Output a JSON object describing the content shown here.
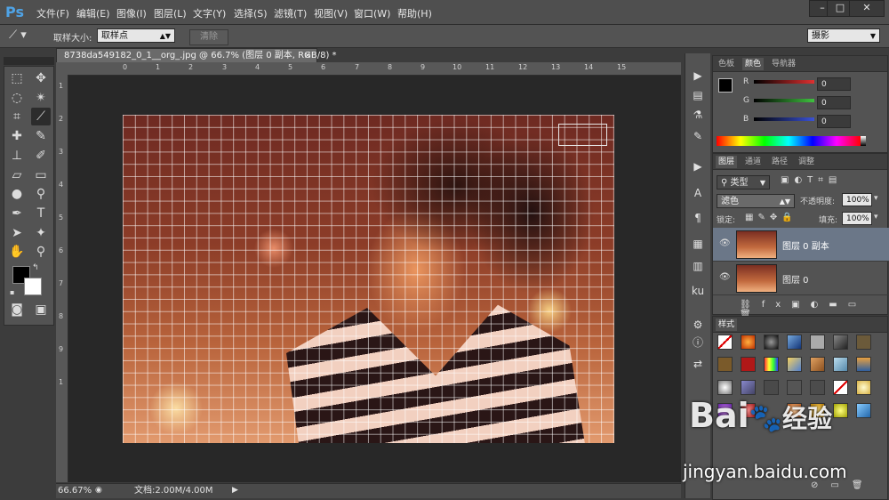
{
  "app": {
    "logo": "Ps",
    "menu": [
      "文件(F)",
      "编辑(E)",
      "图像(I)",
      "图层(L)",
      "文字(Y)",
      "选择(S)",
      "滤镜(T)",
      "视图(V)",
      "窗口(W)",
      "帮助(H)"
    ],
    "window_buttons": [
      "–",
      "□",
      "✕"
    ]
  },
  "options": {
    "sample_size_label": "取样大小:",
    "sample_size_value": "取样点",
    "clear_button": "清除",
    "workspace": "摄影"
  },
  "document": {
    "tab_title": "8738da549182_0_1__org_.jpg @ 66.7% (图层 0 副本, RGB/8) *",
    "tab_close": "×",
    "ruler_top": [
      "0",
      "1",
      "2",
      "3",
      "4",
      "5",
      "6",
      "7",
      "8",
      "9",
      "10",
      "11",
      "12",
      "13",
      "14",
      "15"
    ],
    "ruler_left": [
      "1",
      "2",
      "3",
      "4",
      "5",
      "6",
      "7",
      "8",
      "9",
      "1"
    ],
    "zoom": "66.67%",
    "doc_size": "文档:2.00M/4.00M"
  },
  "color_panel": {
    "tabs": [
      "色板",
      "颜色",
      "导航器"
    ],
    "active_tab": "颜色",
    "channels": [
      {
        "label": "R",
        "value": "0",
        "color": "#d23a3a"
      },
      {
        "label": "G",
        "value": "0",
        "color": "#3fc23f"
      },
      {
        "label": "B",
        "value": "0",
        "color": "#3a52d6"
      }
    ]
  },
  "layers_panel": {
    "tabs": [
      "图层",
      "通道",
      "路径",
      "调整"
    ],
    "active_tab": "图层",
    "filter_kind": "类型",
    "blend_mode": "滤色",
    "opacity_label": "不透明度:",
    "opacity_value": "100%",
    "lock_label": "锁定:",
    "fill_label": "填充:",
    "fill_value": "100%",
    "layers": [
      {
        "name": "图层 0 副本",
        "selected": true
      },
      {
        "name": "图层 0",
        "selected": false
      }
    ]
  },
  "styles_panel": {
    "title": "样式"
  },
  "watermark": {
    "brand": "Bai",
    "brand2": "经验",
    "url": "jingyan.baidu.com"
  }
}
